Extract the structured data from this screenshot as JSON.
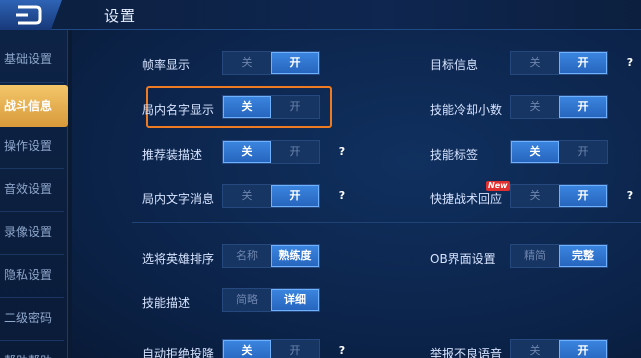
{
  "header": {
    "title": "设置"
  },
  "sidebar": {
    "items": [
      {
        "label": "基础设置",
        "active": false
      },
      {
        "label": "战斗信息",
        "active": true
      },
      {
        "label": "操作设置",
        "active": false
      },
      {
        "label": "音效设置",
        "active": false
      },
      {
        "label": "录像设置",
        "active": false
      },
      {
        "label": "隐私设置",
        "active": false
      },
      {
        "label": "二级密码",
        "active": false
      },
      {
        "label": "帮助帮助",
        "active": false
      }
    ]
  },
  "settings": {
    "fps": {
      "label": "帧率显示",
      "off": "关",
      "on": "开",
      "value": "开"
    },
    "target_info": {
      "label": "目标信息",
      "off": "关",
      "on": "开",
      "value": "开"
    },
    "in_game_names": {
      "label": "局内名字显示",
      "off": "关",
      "on": "开",
      "value": "关"
    },
    "skill_cd_decimal": {
      "label": "技能冷却小数",
      "off": "关",
      "on": "开",
      "value": "开"
    },
    "recommended_gear": {
      "label": "推荐装描述",
      "off": "关",
      "on": "开",
      "value": "关"
    },
    "skill_tags": {
      "label": "技能标签",
      "off": "关",
      "on": "开",
      "value": "关"
    },
    "in_game_text": {
      "label": "局内文字消息",
      "off": "关",
      "on": "开",
      "value": "开"
    },
    "quick_tactic": {
      "label": "快捷战术回应",
      "badge": "New",
      "off": "关",
      "on": "开",
      "value": "开"
    },
    "hero_sort": {
      "label": "选将英雄排序",
      "a": "名称",
      "b": "熟练度",
      "value": "熟练度"
    },
    "ob_ui": {
      "label": "OB界面设置",
      "a": "精简",
      "b": "完整",
      "value": "完整"
    },
    "skill_desc": {
      "label": "技能描述",
      "a": "简略",
      "b": "详细",
      "value": "详细"
    },
    "auto_refuse_surrender": {
      "label": "自动拒绝投降",
      "off": "关",
      "on": "开",
      "value": "关"
    },
    "report_voice": {
      "label": "举报不良语音",
      "off": "关",
      "on": "开",
      "value": "开"
    }
  },
  "help_mark": "?"
}
